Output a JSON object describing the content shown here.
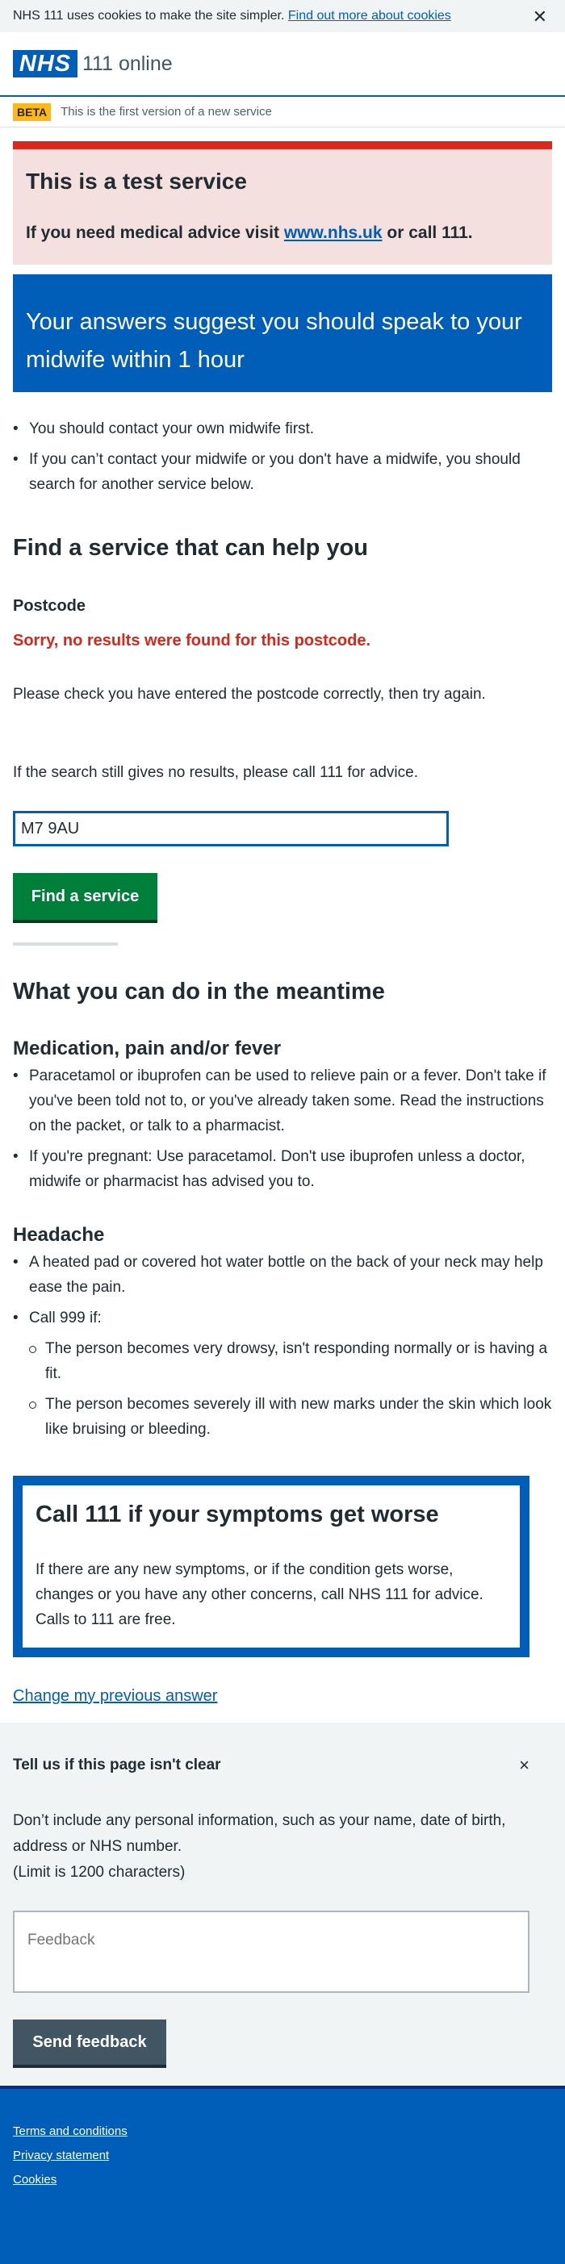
{
  "cookie_bar": {
    "text": "NHS 111 uses cookies to make the site simpler.",
    "link": "Find out more about cookies",
    "close": "✕"
  },
  "header": {
    "logo": "NHS",
    "service_name": "111 online"
  },
  "beta": {
    "tag": "BETA",
    "text": "This is the first version of a new service"
  },
  "test_panel": {
    "title": "This is a test service",
    "text_before": "If you need medical advice visit",
    "link": "www.nhs.uk",
    "text_after": "or call 111."
  },
  "result": {
    "title": "Your answers suggest you should speak to your midwife within 1 hour"
  },
  "advice_list": [
    "You should contact your own midwife first.",
    "If you can’t contact your midwife or you don't have a midwife, you should search for another service below."
  ],
  "find_service": {
    "heading": "Find a service that can help you",
    "postcode_label": "Postcode",
    "error": "Sorry, no results were found for this postcode.",
    "check_text": "Please check you have entered the postcode correctly, then try again.",
    "call_text": "If the search still gives no results, please call 111 for advice.",
    "postcode_value": "M7 9AU",
    "button": "Find a service"
  },
  "meantime": {
    "heading": "What you can do in the meantime",
    "medication": {
      "heading": "Medication, pain and/or fever",
      "items": [
        "Paracetamol or ibuprofen can be used to relieve pain or a fever. Don't take if you've been told not to, or you've already taken some. Read the instructions on the packet, or talk to a pharmacist.",
        "If you're pregnant: Use paracetamol. Don't use ibuprofen unless a doctor, midwife or pharmacist has advised you to."
      ]
    },
    "headache": {
      "heading": "Headache",
      "items": [
        "A heated pad or covered hot water bottle on the back of your neck may help ease the pain.",
        "Call 999 if:"
      ],
      "sub_items": [
        "The person becomes very drowsy, isn't responding normally or is having a fit.",
        "The person becomes severely ill with new marks under the skin which look like bruising or bleeding."
      ]
    }
  },
  "care_card": {
    "heading": "Call 111 if your symptoms get worse",
    "text": "If there are any new symptoms, or if the condition gets worse, changes or you have any other concerns, call NHS 111 for advice. Calls to 111 are free."
  },
  "change_answer_link": "Change my previous answer",
  "feedback": {
    "title": "Tell us if this page isn't clear",
    "close": "×",
    "text": "Don’t include any personal information, such as your name, date of birth, address or NHS number.",
    "limit": "(Limit is 1200 characters)",
    "placeholder": "Feedback",
    "button": "Send feedback"
  },
  "footer": {
    "links": [
      "Terms and conditions",
      "Privacy statement",
      "Cookies"
    ]
  },
  "colors": {
    "nhs_blue": "#005eb8",
    "nhs_green": "#007f3b",
    "error_red": "#d5281b",
    "warning_yellow": "#ffb81c",
    "test_panel_bg": "#f4e0de",
    "test_panel_border": "#da291c"
  }
}
